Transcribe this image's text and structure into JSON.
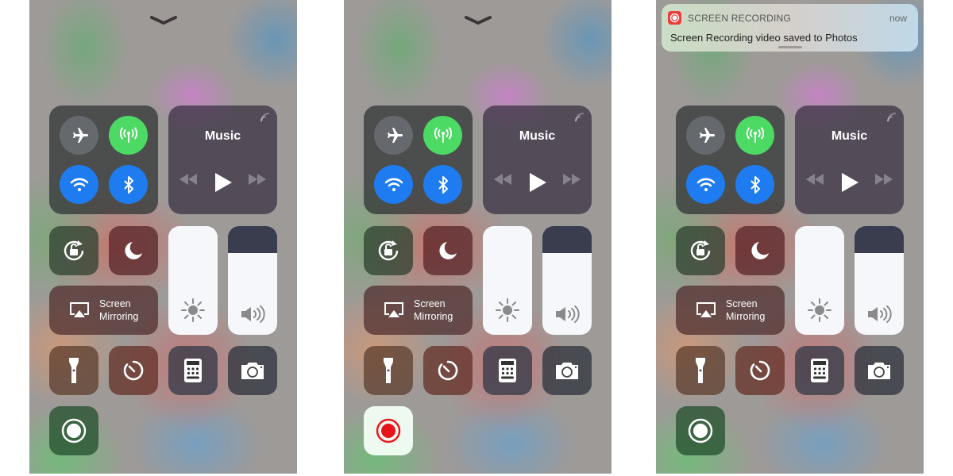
{
  "panels": [
    {
      "id": "before",
      "show_dismiss_chevron": true,
      "notification": null,
      "screen_recording_active": false
    },
    {
      "id": "recording",
      "show_dismiss_chevron": true,
      "notification": null,
      "screen_recording_active": true
    },
    {
      "id": "after",
      "show_dismiss_chevron": false,
      "notification": {
        "app_name": "SCREEN RECORDING",
        "time": "now",
        "message": "Screen Recording video saved to Photos",
        "app_icon": "screen-record-icon"
      },
      "screen_recording_active": false
    }
  ],
  "control_center": {
    "connectivity": {
      "airplane_mode": {
        "icon": "airplane-icon",
        "on": false
      },
      "cellular_data": {
        "icon": "antenna-icon",
        "on": true,
        "color": "#4cd964"
      },
      "wifi": {
        "icon": "wifi-icon",
        "on": true,
        "color": "#1e7cf0"
      },
      "bluetooth": {
        "icon": "bluetooth-icon",
        "on": true,
        "color": "#1e7cf0"
      }
    },
    "music": {
      "title": "Music",
      "controls": [
        "rewind-icon",
        "play-icon",
        "fast-forward-icon"
      ]
    },
    "orientation_lock": {
      "icon": "rotation-lock-icon"
    },
    "do_not_disturb": {
      "icon": "moon-icon"
    },
    "screen_mirroring": {
      "line1": "Screen",
      "line2": "Mirroring",
      "icon": "airplay-icon"
    },
    "brightness": {
      "icon": "sun-icon",
      "level": 1.0
    },
    "volume": {
      "icon": "speaker-icon",
      "level": 0.75
    },
    "shortcuts": [
      {
        "name": "flashlight",
        "icon": "flashlight-icon"
      },
      {
        "name": "timer",
        "icon": "timer-icon"
      },
      {
        "name": "calculator",
        "icon": "calculator-icon"
      },
      {
        "name": "camera",
        "icon": "camera-icon"
      }
    ],
    "screen_recording": {
      "icon": "screen-record-icon",
      "active_color": "#e8141c"
    }
  },
  "notification": {
    "app_name": "SCREEN RECORDING",
    "time": "now",
    "message": "Screen Recording video saved to Photos"
  }
}
